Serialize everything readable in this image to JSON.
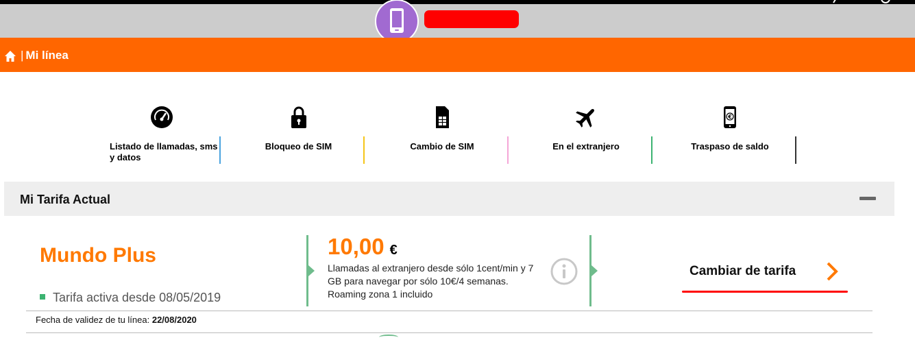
{
  "header": {
    "breadcrumb_separator": "|",
    "title": "Mi línea",
    "avatar_color": "#a16ad1",
    "redaction_color": "#ff0000"
  },
  "shortcuts": [
    {
      "label": "Listado de llamadas, sms y datos",
      "icon": "speedometer-icon",
      "divider_color": "#4aa3df"
    },
    {
      "label": "Bloqueo de SIM",
      "icon": "lock-icon",
      "divider_color": "#f5c518"
    },
    {
      "label": "Cambio de SIM",
      "icon": "sim-card-icon",
      "divider_color": "#f4a6d7"
    },
    {
      "label": "En el extranjero",
      "icon": "airplane-icon",
      "divider_color": "#3cb371"
    },
    {
      "label": "Traspaso de saldo",
      "icon": "phone-euro-icon",
      "divider_color": "#333333"
    }
  ],
  "tariff": {
    "section_title": "Mi Tarifa Actual",
    "plan_name": "Mundo Plus",
    "active_since": "Tarifa activa desde 08/05/2019",
    "price": "10,00",
    "currency": "€",
    "description": "Llamadas al extranjero desde sólo 1cent/min y 7 GB para navegar por sólo 10€/4 semanas. Roaming zona 1 incluido",
    "change_label": "Cambiar de tarifa",
    "validity_label": "Fecha de validez de tu línea: ",
    "validity_date": "22/08/2020"
  },
  "colors": {
    "brand_orange": "#ff6600",
    "accent_orange": "#ff7900",
    "accent_green": "#6fbc8c"
  }
}
